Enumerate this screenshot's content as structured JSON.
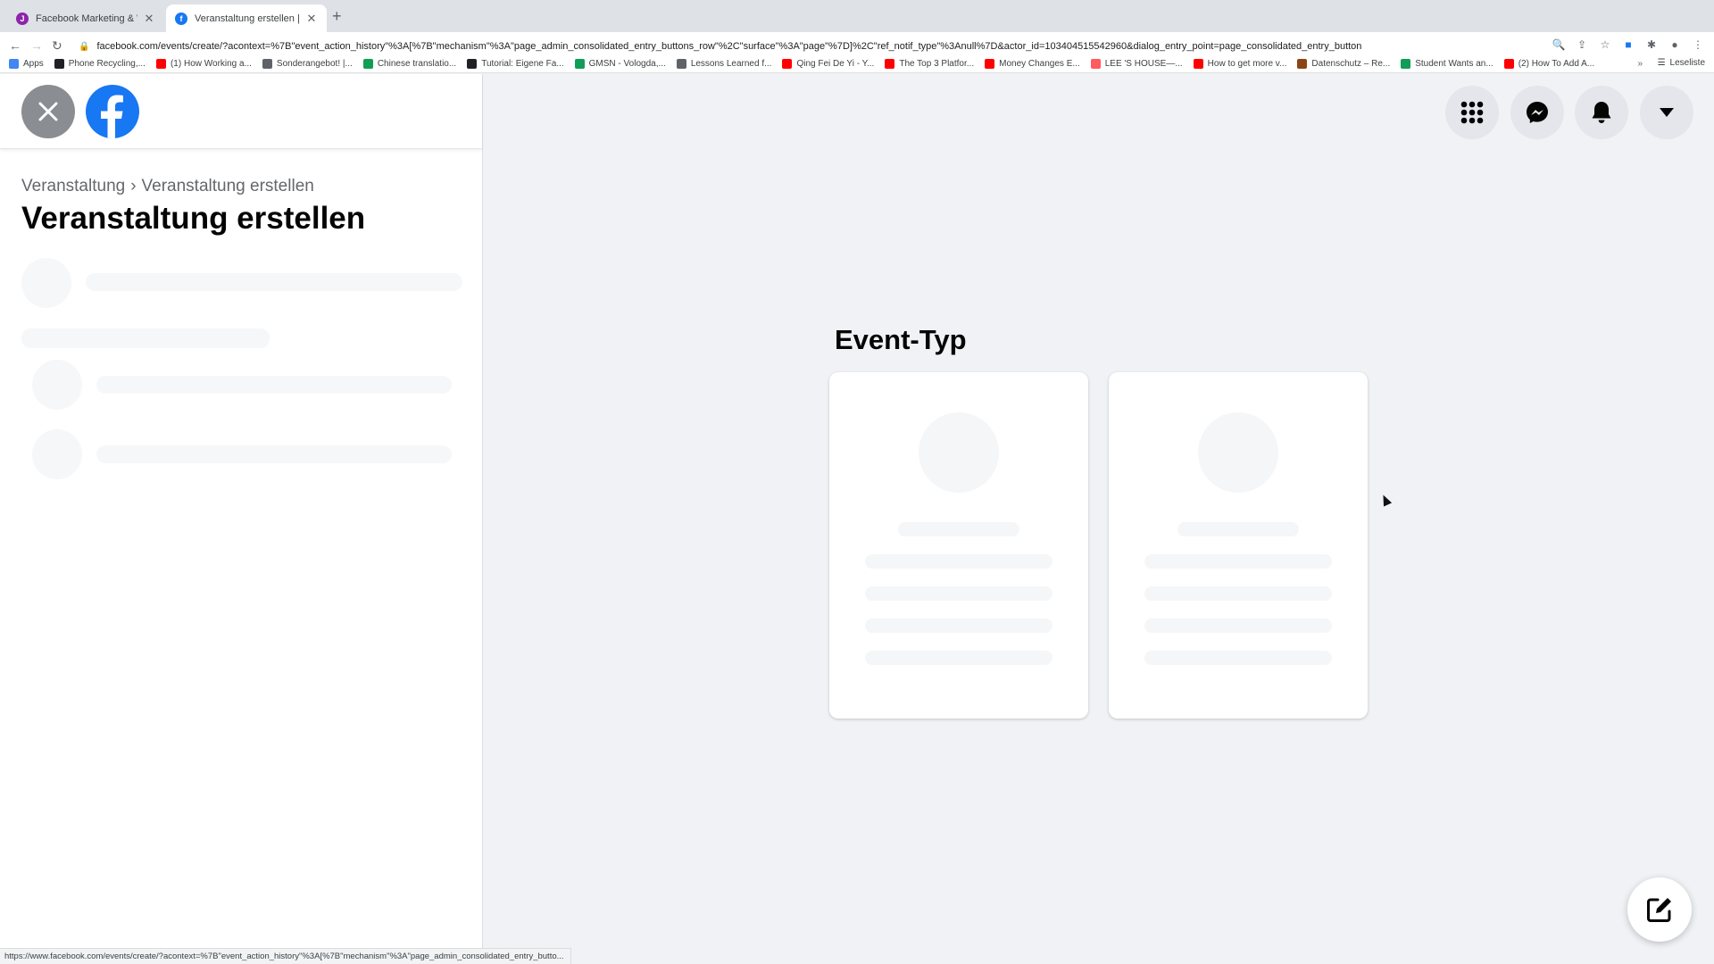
{
  "browser": {
    "tabs": [
      {
        "title": "Facebook Marketing & Werbea",
        "active": false
      },
      {
        "title": "Veranstaltung erstellen | Faceb",
        "active": true
      }
    ],
    "address": "facebook.com/events/create/?acontext=%7B\"event_action_history\"%3A[%7B\"mechanism\"%3A\"page_admin_consolidated_entry_buttons_row\"%2C\"surface\"%3A\"page\"%7D]%2C\"ref_notif_type\"%3Anull%7D&actor_id=103404515542960&dialog_entry_point=page_consolidated_entry_button",
    "bookmarks": [
      {
        "label": "Apps",
        "color": "#4285f4"
      },
      {
        "label": "Phone Recycling,...",
        "color": "#202124"
      },
      {
        "label": "(1) How Working a...",
        "color": "#ff0000"
      },
      {
        "label": "Sonderangebot! |...",
        "color": "#5f6368"
      },
      {
        "label": "Chinese translatio...",
        "color": "#0f9d58"
      },
      {
        "label": "Tutorial: Eigene Fa...",
        "color": "#202124"
      },
      {
        "label": "GMSN - Vologda,...",
        "color": "#0f9d58"
      },
      {
        "label": "Lessons Learned f...",
        "color": "#5f6368"
      },
      {
        "label": "Qing Fei De Yi - Y...",
        "color": "#ff0000"
      },
      {
        "label": "The Top 3 Platfor...",
        "color": "#ff0000"
      },
      {
        "label": "Money Changes E...",
        "color": "#ff0000"
      },
      {
        "label": "LEE 'S HOUSE—...",
        "color": "#ff5a5f"
      },
      {
        "label": "How to get more v...",
        "color": "#ff0000"
      },
      {
        "label": "Datenschutz – Re...",
        "color": "#8b4513"
      },
      {
        "label": "Student Wants an...",
        "color": "#0f9d58"
      },
      {
        "label": "(2) How To Add A...",
        "color": "#ff0000"
      }
    ],
    "more_bookmarks": "»",
    "reading_list": "Leseliste",
    "status_url": "https://www.facebook.com/events/create/?acontext=%7B\"event_action_history\"%3A[%7B\"mechanism\"%3A\"page_admin_consolidated_entry_butto..."
  },
  "sidebar": {
    "breadcrumb_parent": "Veranstaltung",
    "breadcrumb_sep": "›",
    "breadcrumb_current": "Veranstaltung erstellen",
    "title": "Veranstaltung erstellen"
  },
  "main": {
    "section_title": "Event-Typ"
  },
  "colors": {
    "facebook_blue": "#1877f2",
    "page_bg": "#f0f2f5",
    "skeleton": "#f0f2f5"
  },
  "icons": {
    "close": "close-icon",
    "logo": "facebook-logo-icon",
    "menu": "menu-grid-icon",
    "messenger": "messenger-icon",
    "notifications": "bell-icon",
    "account": "caret-down-icon",
    "compose": "compose-icon"
  }
}
